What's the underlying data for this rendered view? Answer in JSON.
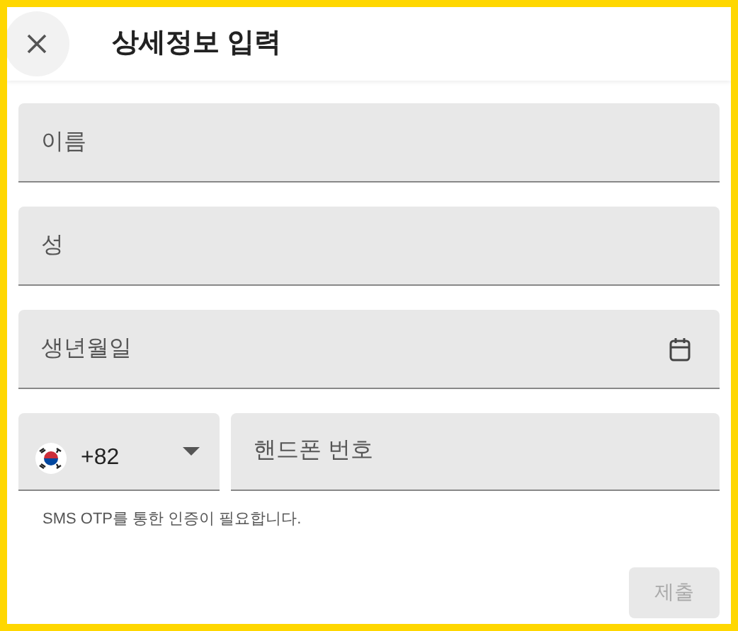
{
  "header": {
    "title": "상세정보 입력"
  },
  "fields": [
    {
      "kind": "text",
      "placeholder": "이름"
    },
    {
      "kind": "text",
      "placeholder": "성"
    },
    {
      "kind": "date",
      "placeholder": "생년월일"
    }
  ],
  "phone": {
    "country_code": "+82",
    "placeholder": "핸드폰 번호"
  },
  "hint": "SMS OTP를 통한 인증이 필요합니다.",
  "submit": {
    "label": "제출",
    "disabled": true
  }
}
